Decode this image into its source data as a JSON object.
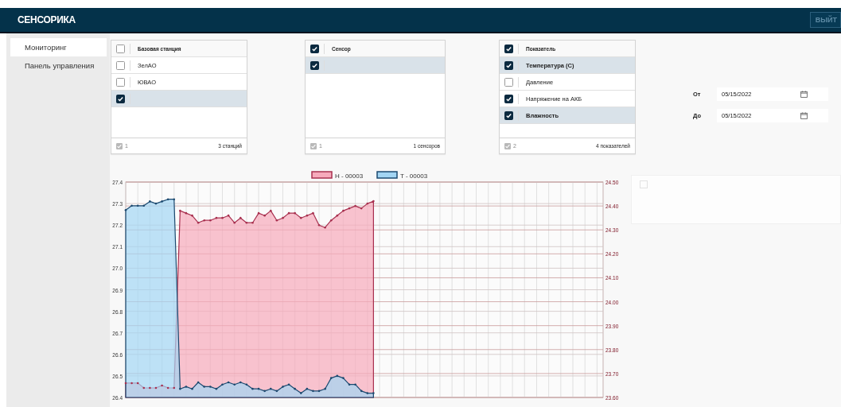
{
  "header": {
    "title": "СЕНСОРИКА",
    "logout_button": "ВЫЙТ"
  },
  "sidebar": {
    "items": [
      {
        "label": "Мониторинг",
        "selected": true
      },
      {
        "label": "Панель управления",
        "selected": false
      }
    ]
  },
  "lists": [
    {
      "header": {
        "label": "Базовая станция",
        "checked": false
      },
      "rows": [
        {
          "label": "ЗелАО",
          "checked": false,
          "selected": false
        },
        {
          "label": "ЮВАО",
          "checked": false,
          "selected": false
        },
        {
          "checked": true,
          "selected": true
        }
      ],
      "footer": {
        "count": "1",
        "total": "3 станций"
      }
    },
    {
      "header": {
        "label": "Сенсор",
        "checked": true
      },
      "rows": [
        {
          "checked": true,
          "selected": true
        }
      ],
      "footer": {
        "count": "1",
        "total": "1 сенсоров"
      }
    },
    {
      "header": {
        "label": "Показатель",
        "checked": true
      },
      "rows": [
        {
          "label": "Температура (С)",
          "checked": true,
          "selected": true
        },
        {
          "label": "Давление",
          "checked": false,
          "selected": false
        },
        {
          "label": "Напряжение на АКБ",
          "checked": true,
          "selected": false
        },
        {
          "label": "Влажность",
          "checked": true,
          "selected": true
        }
      ],
      "footer": {
        "count": "2",
        "total": "4 показателей"
      }
    }
  ],
  "dates": [
    {
      "label": "От",
      "value": "05/15/2022"
    },
    {
      "label": "До",
      "value": "05/15/2022"
    }
  ],
  "chart": {
    "chart_data": {
      "type": "area",
      "ylim": [
        26.4,
        27.4
      ],
      "yticks": [
        26.4,
        26.5,
        26.6,
        26.7,
        26.8,
        26.9,
        {
          "value": 27.0,
          "label": "27.0"
        },
        27.1,
        27.2,
        27.3,
        27.4
      ],
      "y2lim": [
        23.6,
        24.5
      ],
      "y2ticks": [
        {
          "value": 23.6,
          "label": "23.60"
        },
        {
          "value": 23.7,
          "label": "23.70"
        },
        {
          "value": 23.8,
          "label": "23.80"
        },
        {
          "value": 23.9,
          "label": "23.90"
        },
        {
          "value": 24.0,
          "label": "24.00"
        },
        {
          "value": 24.1,
          "label": "24.10"
        },
        {
          "value": 24.2,
          "label": "24.20"
        },
        {
          "value": 24.3,
          "label": "24.30"
        },
        {
          "value": 24.4,
          "label": "24.40"
        },
        {
          "value": 24.5,
          "label": "24.50"
        }
      ],
      "grid": true,
      "legend": "top",
      "series": [
        {
          "name": "H - 00003",
          "axis": "y2",
          "color": "#f6aabb",
          "values": [
            23.66,
            23.66,
            23.66,
            23.64,
            23.64,
            23.64,
            23.65,
            23.64,
            23.64,
            24.38,
            24.37,
            24.36,
            24.33,
            24.34,
            24.34,
            24.35,
            24.35,
            24.36,
            24.33,
            24.35,
            24.33,
            24.33,
            24.37,
            24.36,
            24.38,
            24.34,
            24.35,
            24.37,
            24.37,
            24.35,
            24.36,
            24.37,
            24.32,
            24.31,
            24.34,
            24.36,
            24.38,
            24.39,
            24.4,
            24.39,
            24.41,
            24.42,
            null,
            null,
            null,
            null,
            null,
            null,
            null,
            null,
            null,
            null,
            null,
            null,
            null,
            null,
            null,
            null,
            null,
            null,
            null,
            null,
            null,
            null,
            null,
            null,
            null,
            null,
            null,
            null,
            null,
            null,
            null,
            null,
            null,
            null,
            null,
            null,
            null,
            null
          ]
        },
        {
          "name": "T - 00003",
          "color": "#a3d5f3",
          "values": [
            27.27,
            27.29,
            27.29,
            27.29,
            27.31,
            27.3,
            27.31,
            27.32,
            27.32,
            26.44,
            26.45,
            26.44,
            26.47,
            26.45,
            26.45,
            26.44,
            26.46,
            26.47,
            26.46,
            26.47,
            26.46,
            26.44,
            26.44,
            26.43,
            26.44,
            26.43,
            26.45,
            26.46,
            26.44,
            26.42,
            26.44,
            26.43,
            26.43,
            26.44,
            26.49,
            26.5,
            26.49,
            26.46,
            26.46,
            26.43,
            26.42,
            26.42,
            null,
            null,
            null,
            null,
            null,
            null,
            null,
            null,
            null,
            null,
            null,
            null,
            null,
            null,
            null,
            null,
            null,
            null,
            null,
            null,
            null,
            null,
            null,
            null,
            null,
            null,
            null,
            null,
            null,
            null,
            null,
            null,
            null,
            null,
            null,
            null,
            null,
            null
          ]
        }
      ]
    }
  }
}
